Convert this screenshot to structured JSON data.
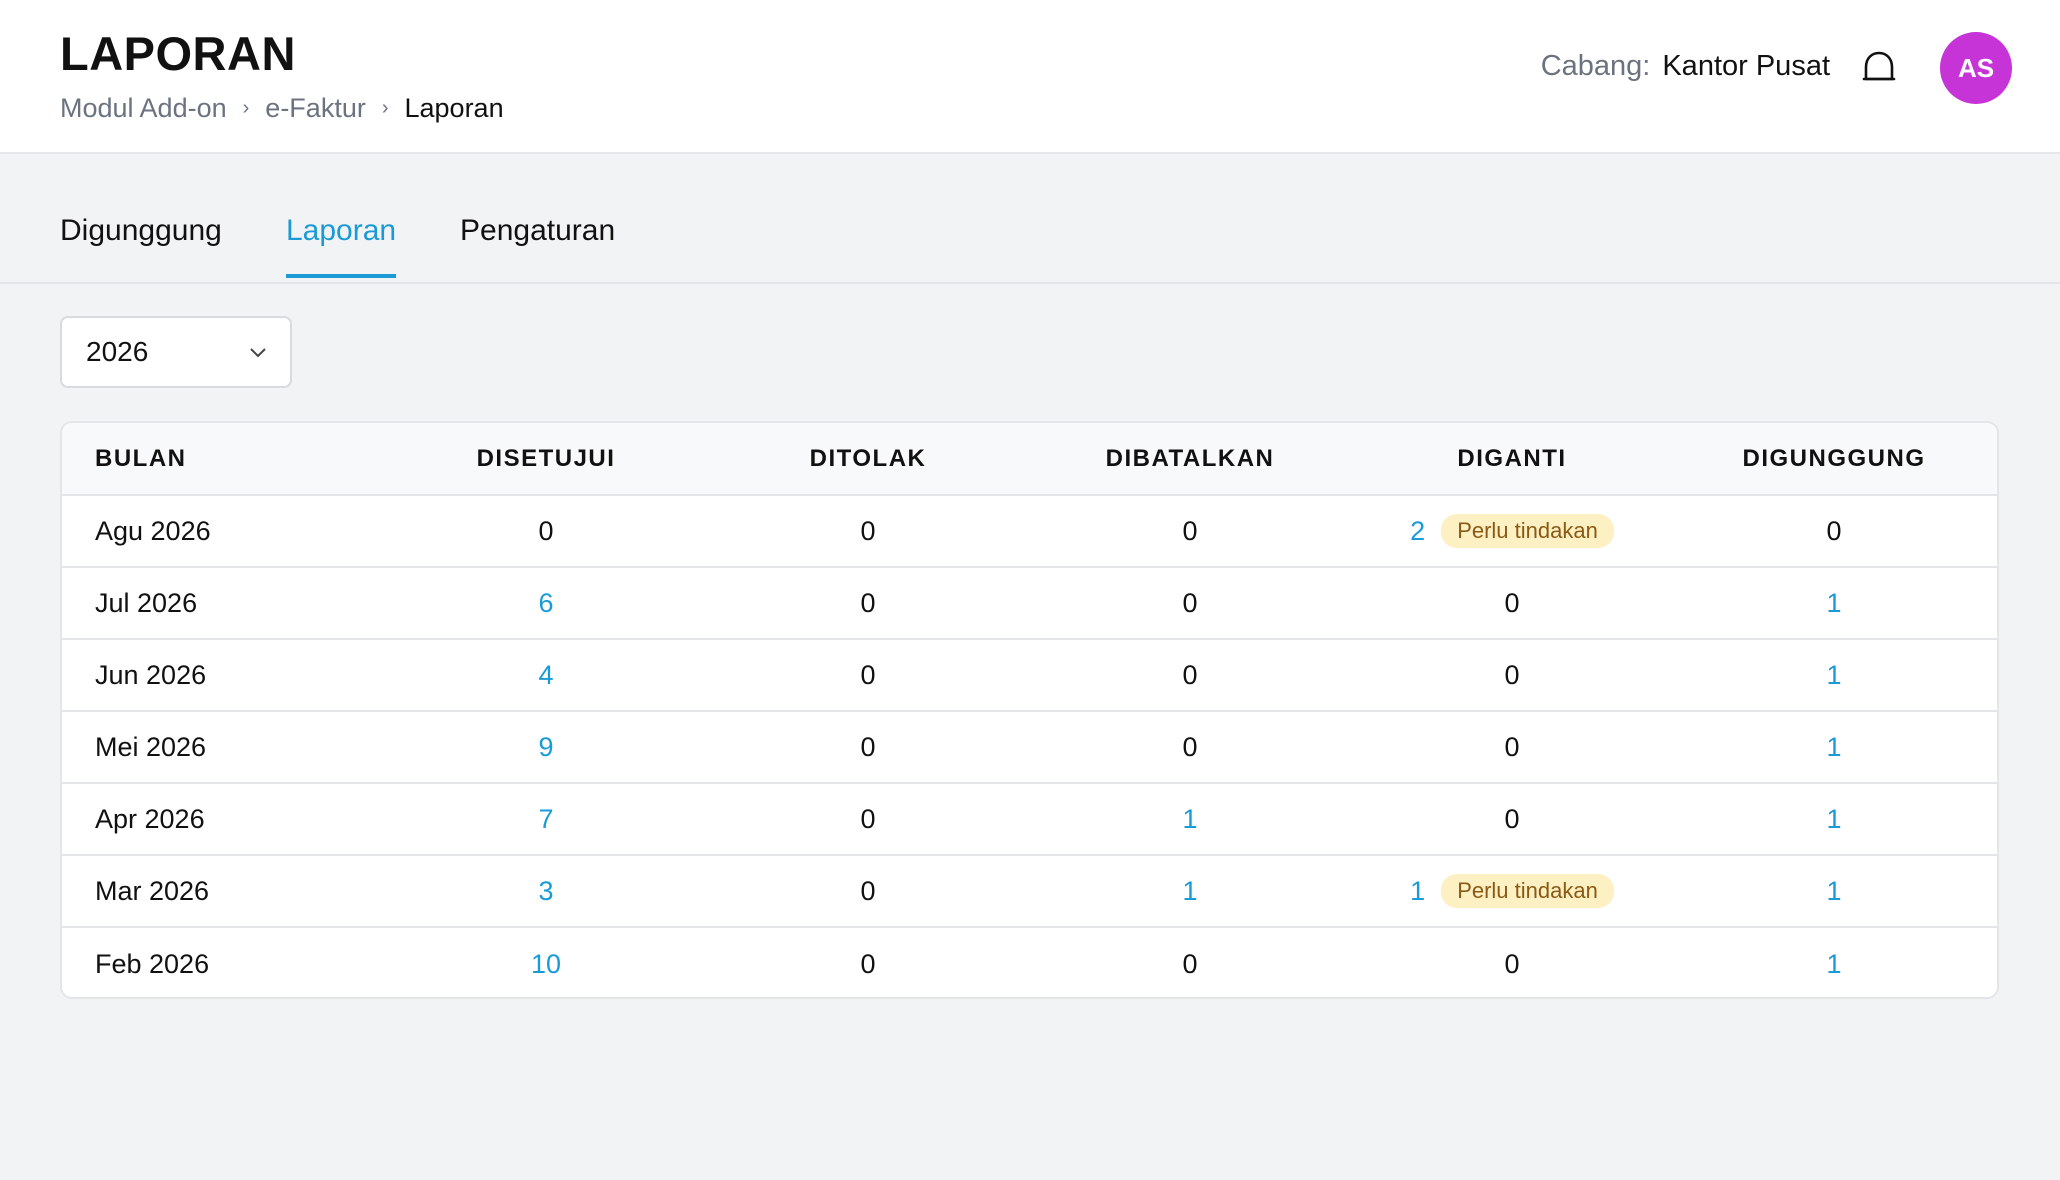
{
  "header": {
    "title": "LAPORAN",
    "breadcrumb": [
      "Modul Add-on",
      "e-Faktur",
      "Laporan"
    ],
    "branch_label": "Cabang:",
    "branch_value": "Kantor Pusat",
    "avatar_initials": "AS",
    "avatar_color": "#c633d6",
    "bell_icon": "bell-icon"
  },
  "tabs": [
    {
      "label": "Digunggung",
      "active": false
    },
    {
      "label": "Laporan",
      "active": true
    },
    {
      "label": "Pengaturan",
      "active": false
    }
  ],
  "filter": {
    "year": "2026",
    "chevron_icon": "chevron-down-icon"
  },
  "table": {
    "columns": [
      "BULAN",
      "DISETUJUI",
      "DITOLAK",
      "DIBATALKAN",
      "DIGANTI",
      "DIGUNGGUNG"
    ],
    "rows": [
      {
        "bulan": "Agu 2026",
        "disetujui": "0",
        "ditolak": "0",
        "dibatalkan": "0",
        "diganti": "2",
        "diganti_badge": "Perlu tindakan",
        "digunggung": "0"
      },
      {
        "bulan": "Jul 2026",
        "disetujui": "6",
        "ditolak": "0",
        "dibatalkan": "0",
        "diganti": "0",
        "diganti_badge": "",
        "digunggung": "1"
      },
      {
        "bulan": "Jun 2026",
        "disetujui": "4",
        "ditolak": "0",
        "dibatalkan": "0",
        "diganti": "0",
        "diganti_badge": "",
        "digunggung": "1"
      },
      {
        "bulan": "Mei 2026",
        "disetujui": "9",
        "ditolak": "0",
        "dibatalkan": "0",
        "diganti": "0",
        "diganti_badge": "",
        "digunggung": "1"
      },
      {
        "bulan": "Apr 2026",
        "disetujui": "7",
        "ditolak": "0",
        "dibatalkan": "1",
        "diganti": "0",
        "diganti_badge": "",
        "digunggung": "1"
      },
      {
        "bulan": "Mar 2026",
        "disetujui": "3",
        "ditolak": "0",
        "dibatalkan": "1",
        "diganti": "1",
        "diganti_badge": "Perlu tindakan",
        "digunggung": "1"
      },
      {
        "bulan": "Feb 2026",
        "disetujui": "10",
        "ditolak": "0",
        "dibatalkan": "0",
        "diganti": "0",
        "diganti_badge": "",
        "digunggung": "1"
      }
    ]
  },
  "colors": {
    "accent": "#1a9bd7",
    "badge_bg": "#fdf0c2",
    "badge_text": "#8a5a14",
    "page_bg": "#f2f3f5"
  }
}
